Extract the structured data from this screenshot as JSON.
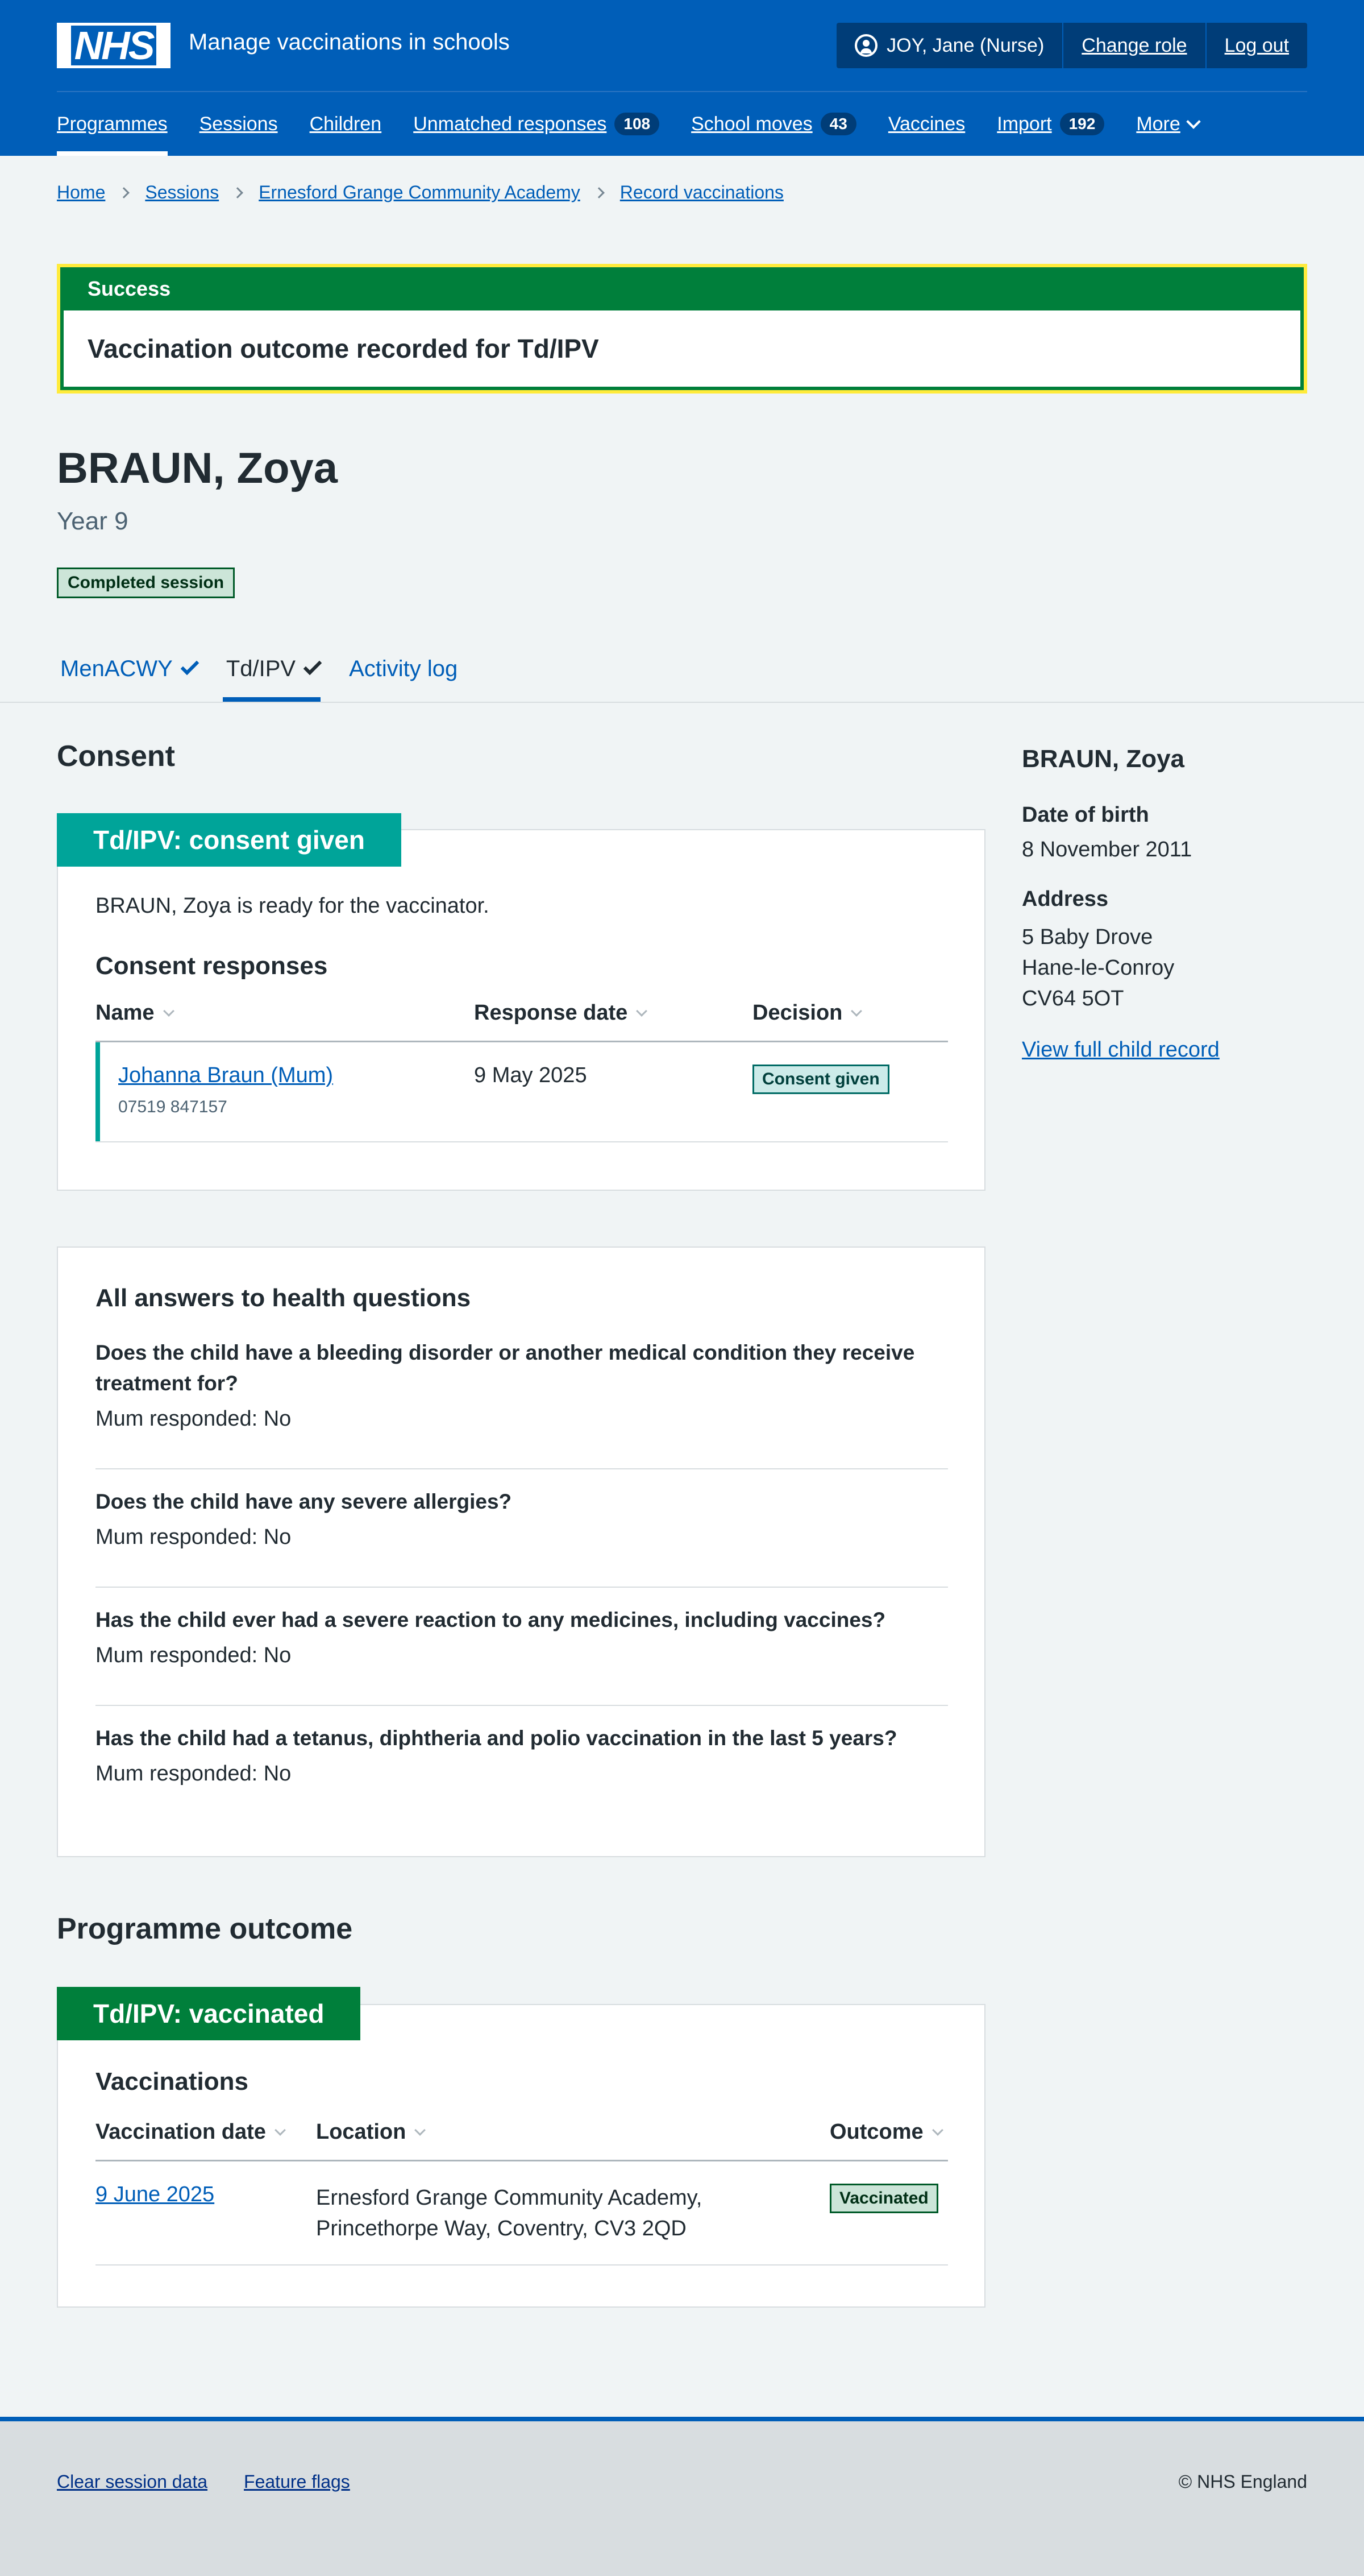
{
  "header": {
    "logo_text": "NHS",
    "service_name": "Manage vaccinations in schools",
    "account": {
      "user": "JOY, Jane (Nurse)",
      "change_role": "Change role",
      "log_out": "Log out"
    },
    "nav": [
      {
        "label": "Programmes",
        "count": null,
        "current": true
      },
      {
        "label": "Sessions",
        "count": null
      },
      {
        "label": "Children",
        "count": null
      },
      {
        "label": "Unmatched responses",
        "count": "108"
      },
      {
        "label": "School moves",
        "count": "43"
      },
      {
        "label": "Vaccines",
        "count": null
      },
      {
        "label": "Import",
        "count": "192"
      },
      {
        "label": "More",
        "count": null
      }
    ]
  },
  "breadcrumb": [
    "Home",
    "Sessions",
    "Ernesford Grange Community Academy",
    "Record vaccinations"
  ],
  "banner": {
    "title": "Success",
    "message": "Vaccination outcome recorded for Td/IPV"
  },
  "patient": {
    "name": "BRAUN, Zoya",
    "year": "Year 9",
    "session_status": "Completed session"
  },
  "tabs": [
    {
      "label": "MenACWY",
      "tick": true,
      "selected": false
    },
    {
      "label": "Td/IPV",
      "tick": true,
      "selected": true
    },
    {
      "label": "Activity log",
      "tick": false,
      "selected": false
    }
  ],
  "consent": {
    "heading": "Consent",
    "card_title": "Td/IPV: consent given",
    "status_text": "BRAUN, Zoya is ready for the vaccinator.",
    "responses_heading": "Consent responses",
    "columns": [
      "Name",
      "Response date",
      "Decision"
    ],
    "rows": [
      {
        "name": "Johanna Braun (Mum)",
        "phone": "07519 847157",
        "date": "9 May 2025",
        "decision": "Consent given"
      }
    ]
  },
  "health": {
    "heading": "All answers to health questions",
    "questions": [
      {
        "q": "Does the child have a bleeding disorder or another medical condition they receive treatment for?",
        "a": "Mum responded: No"
      },
      {
        "q": "Does the child have any severe allergies?",
        "a": "Mum responded: No"
      },
      {
        "q": "Has the child ever had a severe reaction to any medicines, including vaccines?",
        "a": "Mum responded: No"
      },
      {
        "q": "Has the child had a tetanus, diphtheria and polio vaccination in the last 5 years?",
        "a": "Mum responded: No"
      }
    ]
  },
  "outcome": {
    "heading": "Programme outcome",
    "card_title": "Td/IPV: vaccinated",
    "vaccinations_heading": "Vaccinations",
    "columns": [
      "Vaccination date",
      "Location",
      "Outcome"
    ],
    "rows": [
      {
        "date": "9 June 2025",
        "location_line1": "Ernesford Grange Community Academy,",
        "location_line2": "Princethorpe Way, Coventry, CV3 2QD",
        "outcome": "Vaccinated"
      }
    ]
  },
  "sidebar": {
    "name": "BRAUN, Zoya",
    "dob_label": "Date of birth",
    "dob": "8 November 2011",
    "address_label": "Address",
    "address": [
      "5 Baby Drove",
      "Hane-le-Conroy",
      "CV64 5OT"
    ],
    "link": "View full child record"
  },
  "footer": {
    "links": [
      "Clear session data",
      "Feature flags"
    ],
    "copyright": "© NHS England"
  }
}
